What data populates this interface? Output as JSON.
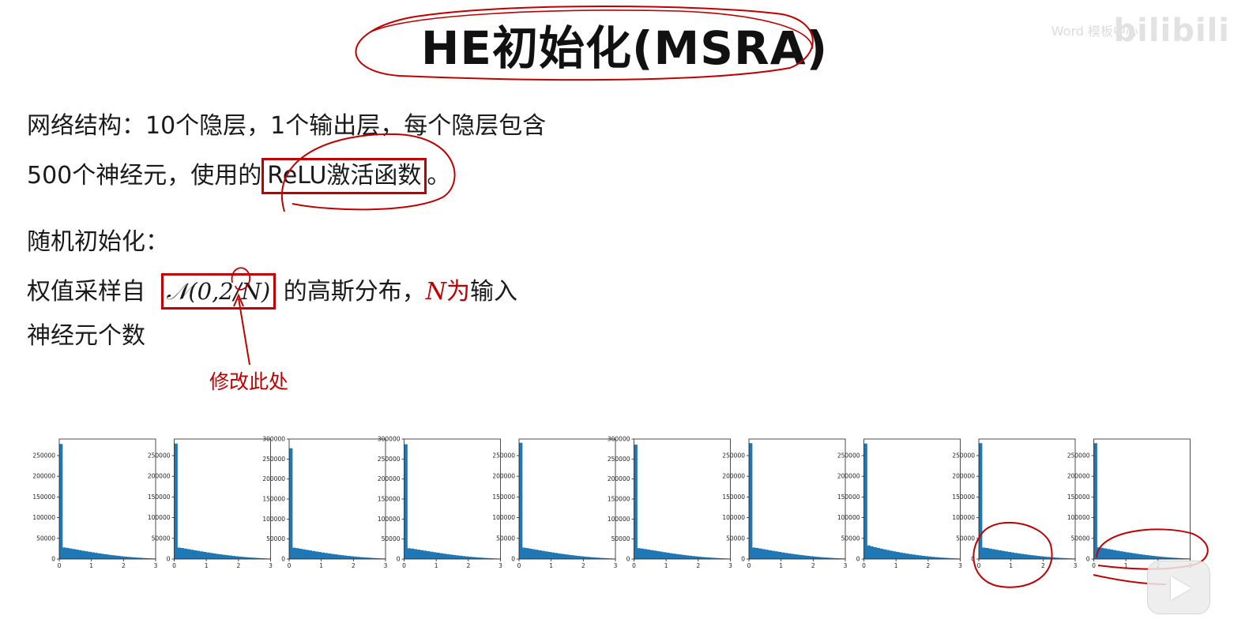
{
  "title": "HE初始化(MSRA)",
  "watermark": {
    "brand": "bilibili",
    "small": "Word 模板中心"
  },
  "text": {
    "line1": "网络结构：10个隐层，1个输出层，每个隐层包含",
    "line2_prefix": "500个神经元，使用的",
    "line2_boxed": "ReLU激活函数",
    "line2_suffix": "。",
    "line3": "随机初始化：",
    "line4_prefix": "权值采样自",
    "line4_formula": "𝒩(0,2/N)",
    "line4_mid": " 的高斯分布，",
    "line4_N": "N",
    "line4_red": "为",
    "line4_suffix": "输入",
    "line5": "神经元个数",
    "note": "修改此处"
  },
  "colors": {
    "annotation_red": "#c00000",
    "bar_blue": "#1f77b4"
  },
  "icons": {
    "play": "play-icon"
  },
  "chart_data": {
    "type": "bar",
    "layout": "10 small histograms in a row",
    "x_ticks": [
      "0",
      "1",
      "2",
      "3"
    ],
    "xlim": [
      0,
      3
    ],
    "bins": [
      0.0,
      0.1,
      0.2,
      0.3,
      0.4,
      0.5,
      0.6,
      0.7,
      0.8,
      0.9,
      1.0,
      1.1,
      1.2,
      1.3,
      1.4,
      1.5,
      1.6,
      1.7,
      1.8,
      1.9,
      2.0,
      2.1,
      2.2,
      2.3,
      2.4,
      2.5,
      2.6,
      2.7,
      2.8,
      2.9
    ],
    "panels": [
      {
        "ylim": [
          0,
          290000
        ],
        "yticks": [
          0,
          50000,
          100000,
          150000,
          200000,
          250000
        ],
        "values": [
          278000,
          28000,
          27000,
          25500,
          24200,
          22800,
          21400,
          20000,
          18700,
          17400,
          16100,
          14900,
          13700,
          12600,
          11500,
          10400,
          9400,
          8500,
          7600,
          6800,
          6000,
          5300,
          4600,
          4000,
          3400,
          2900,
          2400,
          2000,
          1600,
          1300
        ]
      },
      {
        "ylim": [
          0,
          290000
        ],
        "yticks": [
          0,
          50000,
          100000,
          150000,
          200000,
          250000
        ],
        "values": [
          279000,
          27600,
          26600,
          25200,
          23900,
          22500,
          21100,
          19800,
          18500,
          17200,
          15900,
          14700,
          13500,
          12400,
          11300,
          10300,
          9300,
          8400,
          7500,
          6700,
          5900,
          5200,
          4500,
          3900,
          3300,
          2800,
          2300,
          1900,
          1500,
          1200
        ]
      },
      {
        "ylim": [
          0,
          300000
        ],
        "yticks": [
          0,
          50000,
          100000,
          150000,
          200000,
          250000,
          300000
        ],
        "values": [
          277000,
          28400,
          27300,
          25800,
          24400,
          23000,
          21600,
          20200,
          18900,
          17600,
          16300,
          15100,
          13900,
          12800,
          11700,
          10600,
          9600,
          8700,
          7800,
          7000,
          6200,
          5400,
          4700,
          4100,
          3500,
          3000,
          2500,
          2100,
          1700,
          1400
        ]
      },
      {
        "ylim": [
          0,
          300000
        ],
        "yticks": [
          0,
          50000,
          100000,
          150000,
          200000,
          250000,
          300000
        ],
        "values": [
          287000,
          27000,
          26100,
          24800,
          23500,
          22200,
          20900,
          19600,
          18300,
          17000,
          15800,
          14600,
          13400,
          12300,
          11200,
          10200,
          9200,
          8300,
          7400,
          6600,
          5800,
          5100,
          4400,
          3800,
          3200,
          2700,
          2200,
          1800,
          1400,
          1100
        ]
      },
      {
        "ylim": [
          0,
          290000
        ],
        "yticks": [
          0,
          50000,
          100000,
          150000,
          200000,
          250000
        ],
        "values": [
          281000,
          27500,
          26500,
          25100,
          23800,
          22400,
          21000,
          19700,
          18400,
          17100,
          15900,
          14700,
          13500,
          12400,
          11300,
          10300,
          9300,
          8400,
          7500,
          6700,
          5900,
          5200,
          4500,
          3900,
          3300,
          2800,
          2300,
          1900,
          1500,
          1200
        ]
      },
      {
        "ylim": [
          0,
          300000
        ],
        "yticks": [
          0,
          50000,
          100000,
          150000,
          200000,
          250000,
          300000
        ],
        "values": [
          286000,
          27200,
          26200,
          24900,
          23600,
          22300,
          21000,
          19700,
          18400,
          17100,
          15800,
          14600,
          13400,
          12300,
          11200,
          10200,
          9200,
          8300,
          7400,
          6600,
          5800,
          5100,
          4400,
          3800,
          3200,
          2700,
          2200,
          1800,
          1400,
          1100
        ]
      },
      {
        "ylim": [
          0,
          290000
        ],
        "yticks": [
          0,
          50000,
          100000,
          150000,
          200000,
          250000
        ],
        "values": [
          280000,
          27800,
          26800,
          25400,
          24000,
          22600,
          21200,
          19900,
          18600,
          17300,
          16000,
          14800,
          13600,
          12500,
          11400,
          10400,
          9400,
          8500,
          7600,
          6800,
          6000,
          5300,
          4600,
          4000,
          3400,
          2900,
          2400,
          2000,
          1600,
          1300
        ]
      },
      {
        "ylim": [
          0,
          290000
        ],
        "yticks": [
          0,
          50000,
          100000,
          150000,
          200000,
          250000
        ],
        "values": [
          279000,
          33000,
          30500,
          28500,
          26800,
          25000,
          23300,
          21700,
          20100,
          18600,
          17100,
          15700,
          14400,
          13100,
          11900,
          10800,
          9700,
          8700,
          7800,
          6900,
          6100,
          5300,
          4600,
          4000,
          3400,
          2900,
          2400,
          2000,
          1600,
          1300
        ]
      },
      {
        "ylim": [
          0,
          290000
        ],
        "yticks": [
          0,
          50000,
          100000,
          150000,
          200000,
          250000
        ],
        "values": [
          280000,
          27700,
          26700,
          25300,
          23900,
          22500,
          21100,
          19800,
          18500,
          17200,
          15900,
          14700,
          13500,
          12400,
          11300,
          10300,
          9300,
          8400,
          7500,
          6700,
          5900,
          5200,
          4500,
          3900,
          3300,
          2800,
          2300,
          1900,
          1500,
          1200
        ]
      },
      {
        "ylim": [
          0,
          290000
        ],
        "yticks": [
          0,
          50000,
          100000,
          150000,
          200000,
          250000
        ],
        "values": [
          280000,
          28200,
          27100,
          25700,
          24300,
          22900,
          21500,
          20100,
          18800,
          17500,
          16200,
          15000,
          13800,
          12700,
          11600,
          10500,
          9500,
          8600,
          7700,
          6900,
          6100,
          5300,
          4600,
          4000,
          3400,
          2900,
          2400,
          2000,
          1600,
          1300
        ]
      }
    ]
  }
}
